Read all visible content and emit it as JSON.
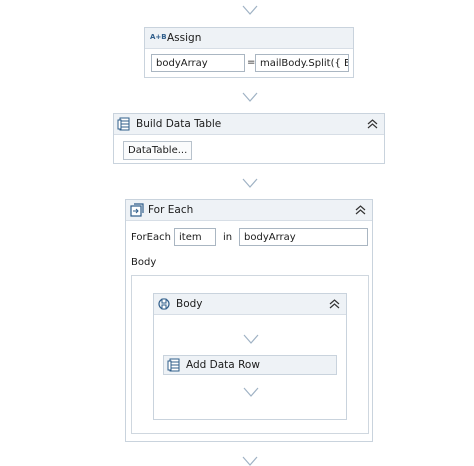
{
  "assign": {
    "icon_text": "A+B",
    "title": "Assign",
    "to_value": "bodyArray",
    "equals": "=",
    "value_expr": "mailBody.Split({ En"
  },
  "build_data_table": {
    "title": "Build Data Table",
    "button_label": "DataTable..."
  },
  "for_each": {
    "title": "For Each",
    "foreach_label": "ForEach",
    "item_value": "item",
    "in_label": "in",
    "collection_value": "bodyArray",
    "body_label": "Body"
  },
  "body_sequence": {
    "title": "Body",
    "child_title": "Add Data Row"
  },
  "icons": [
    "flow-arrow-icon",
    "assign-icon",
    "datatable-icon",
    "foreach-icon",
    "sequence-icon",
    "collapse-icon"
  ],
  "colors": {
    "border": "#c9d3dd",
    "header_bg": "#eef2f6",
    "arrow": "#9fb2c4",
    "icon_blue": "#2f5d8a"
  }
}
